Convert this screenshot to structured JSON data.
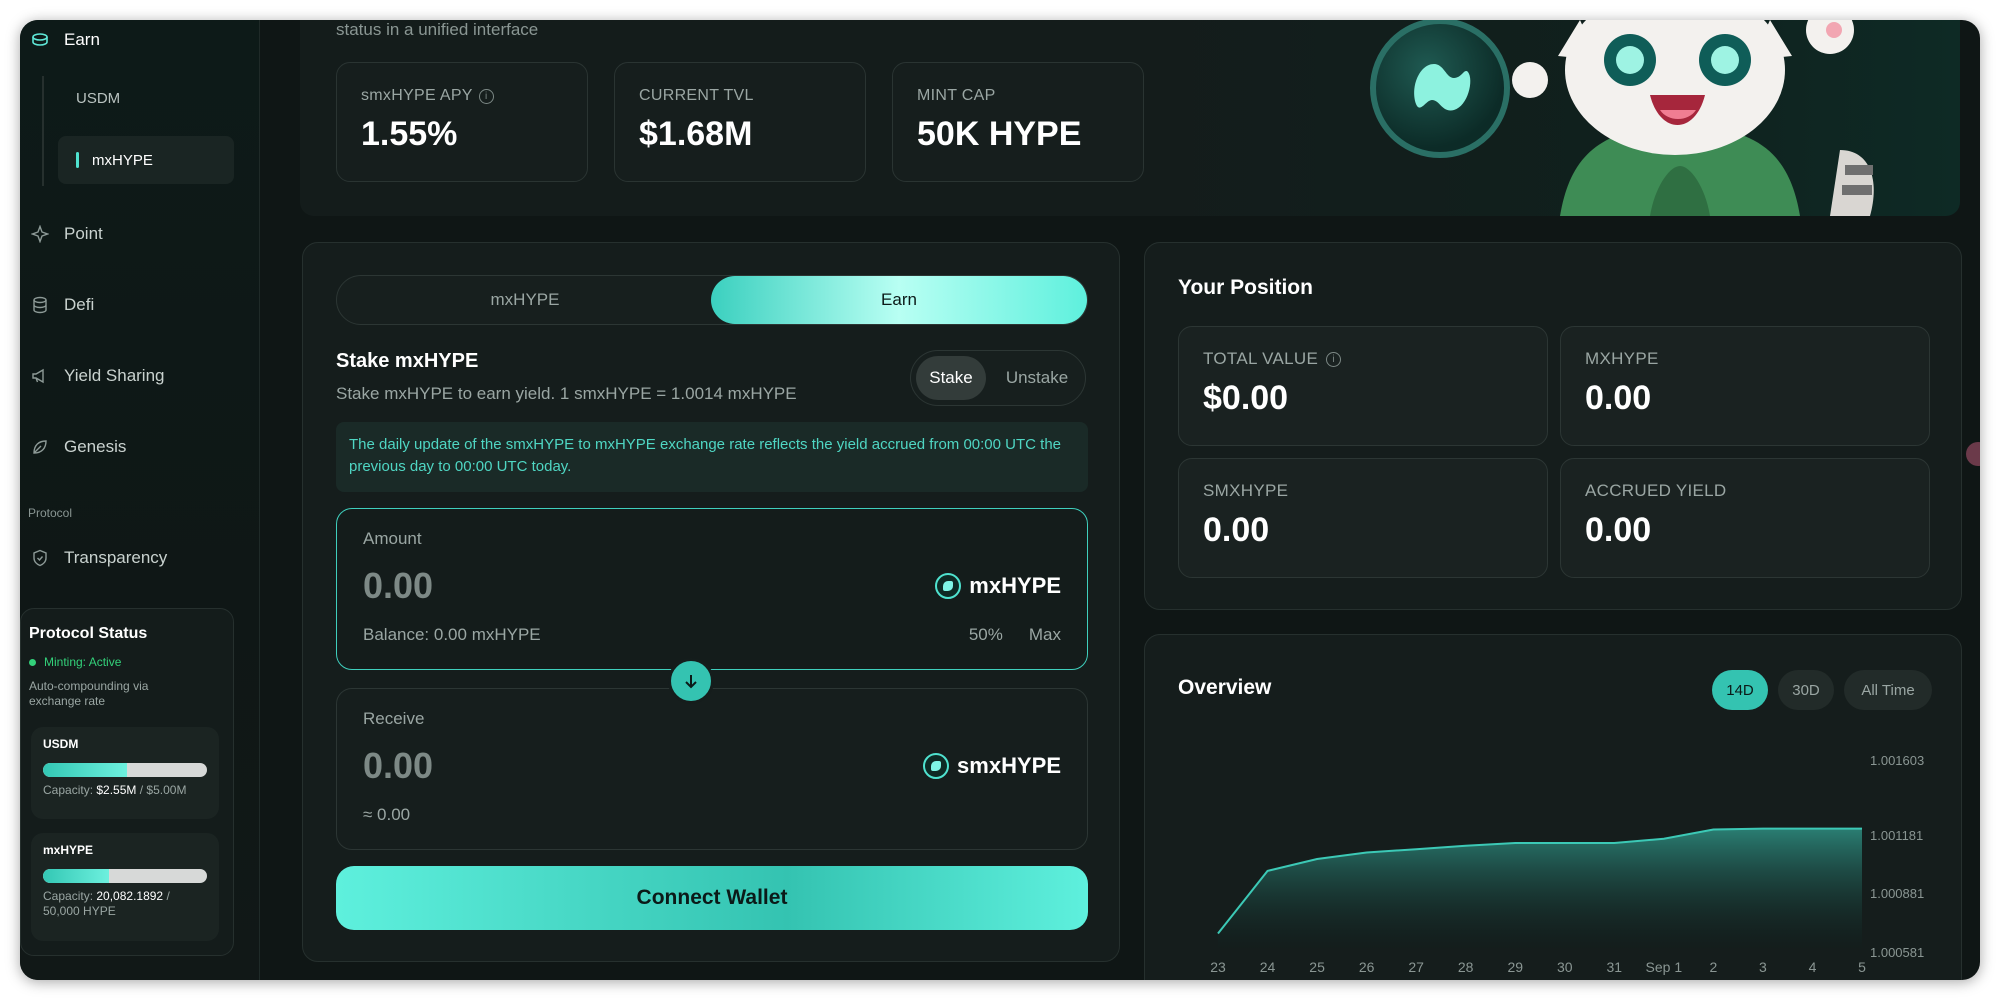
{
  "sidebar": {
    "earn": "Earn",
    "earn_subitems": [
      "USDM",
      "mxHYPE"
    ],
    "items": [
      {
        "label": "Point",
        "icon": "sparkle-icon"
      },
      {
        "label": "Defi",
        "icon": "database-icon"
      },
      {
        "label": "Yield Sharing",
        "icon": "megaphone-icon"
      },
      {
        "label": "Genesis",
        "icon": "leaf-icon"
      }
    ],
    "section": "Protocol",
    "transparency": "Transparency",
    "protocol_status": {
      "title": "Protocol Status",
      "minting": "Minting: Active",
      "desc": "Auto-compounding via exchange rate",
      "caps": [
        {
          "name": "USDM",
          "label": "Capacity:",
          "used": "$2.55M",
          "total": "/ $5.00M",
          "fill": 0.51
        },
        {
          "name": "mxHYPE",
          "label": "Capacity:",
          "used": "20,082.1892",
          "total": "/ 50,000 HYPE",
          "fill": 0.4
        }
      ]
    }
  },
  "header": {
    "subtitle": "status in a unified interface",
    "stats": [
      {
        "label": "smxHYPE APY",
        "value": "1.55%"
      },
      {
        "label": "CURRENT TVL",
        "value": "$1.68M"
      },
      {
        "label": "MINT CAP",
        "value": "50K HYPE"
      }
    ]
  },
  "stake": {
    "tabs": [
      "mxHYPE",
      "Earn"
    ],
    "title": "Stake mxHYPE",
    "subtitle": "Stake mxHYPE to earn yield. 1 smxHYPE = 1.0014 mxHYPE",
    "modes": [
      "Stake",
      "Unstake"
    ],
    "notice": "The daily update of the smxHYPE to mxHYPE exchange rate reflects the yield accrued from 00:00 UTC the previous day to 00:00 UTC today.",
    "amount": {
      "label": "Amount",
      "value": "0.00",
      "token": "mxHYPE",
      "balance": "Balance: 0.00 mxHYPE",
      "half": "50%",
      "max": "Max"
    },
    "receive": {
      "label": "Receive",
      "value": "0.00",
      "token": "smxHYPE",
      "approx": "≈ 0.00"
    },
    "connect": "Connect Wallet"
  },
  "position": {
    "title": "Your Position",
    "cards": [
      {
        "label": "TOTAL VALUE",
        "value": "$0.00"
      },
      {
        "label": "MXHYPE",
        "value": "0.00"
      },
      {
        "label": "SMXHYPE",
        "value": "0.00"
      },
      {
        "label": "ACCRUED YIELD",
        "value": "0.00"
      }
    ]
  },
  "overview": {
    "title": "Overview",
    "ranges": [
      "14D",
      "30D",
      "All Time"
    ],
    "active_range": "14D"
  },
  "chart_data": {
    "type": "area",
    "x": [
      "23",
      "24",
      "25",
      "26",
      "27",
      "28",
      "29",
      "30",
      "31",
      "Sep 1",
      "2",
      "3",
      "4",
      "5"
    ],
    "values": [
      1.00066,
      1.001,
      1.001065,
      1.0011,
      1.001118,
      1.001137,
      1.001152,
      1.001152,
      1.001152,
      1.001175,
      1.001225,
      1.00123,
      1.00123,
      1.00123
    ],
    "yticks": [
      "1.001603",
      "1.001181",
      "1.000881",
      "1.000581"
    ],
    "ylim": [
      1.000581,
      1.001603
    ],
    "color": "#3cc9b6"
  }
}
